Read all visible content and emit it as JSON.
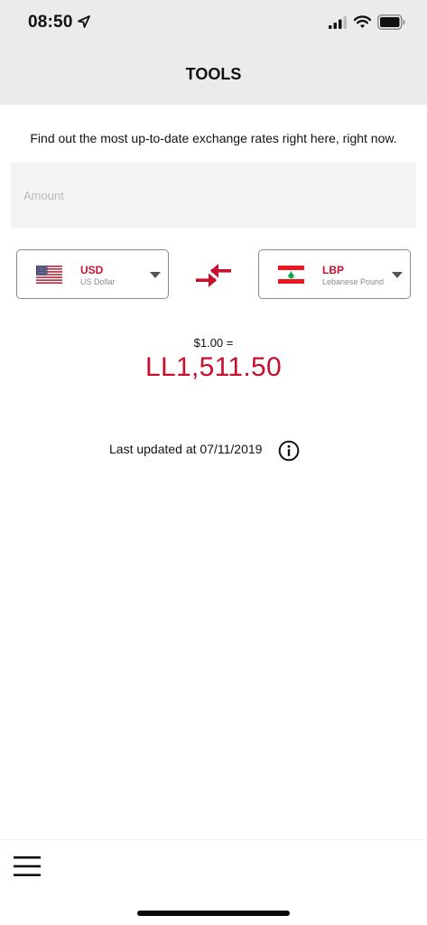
{
  "status_bar": {
    "time": "08:50",
    "icons": [
      "location-arrow-icon",
      "signal-icon",
      "wifi-icon",
      "battery-icon"
    ]
  },
  "nav": {
    "title": "TOOLS"
  },
  "converter": {
    "intro": "Find out the most up-to-date exchange rates right here, right now.",
    "amount_placeholder": "Amount",
    "from": {
      "code": "USD",
      "name": "US Dollar",
      "flag": "us-flag-icon"
    },
    "to": {
      "code": "LBP",
      "name": "Lebanese Pound",
      "flag": "lebanon-flag-icon"
    },
    "base_amount": "$1.00 =",
    "result": "LL1,511.50",
    "last_updated": "Last updated at 07/11/2019"
  },
  "colors": {
    "accent": "#c8102e",
    "header_bg": "#ebebed",
    "input_bg": "#f4f4f4",
    "border": "#8a8a8a"
  },
  "icons": {
    "swap": "swap-arrows-icon",
    "info": "info-icon",
    "menu": "hamburger-menu-icon",
    "dropdown": "caret-down-icon"
  }
}
